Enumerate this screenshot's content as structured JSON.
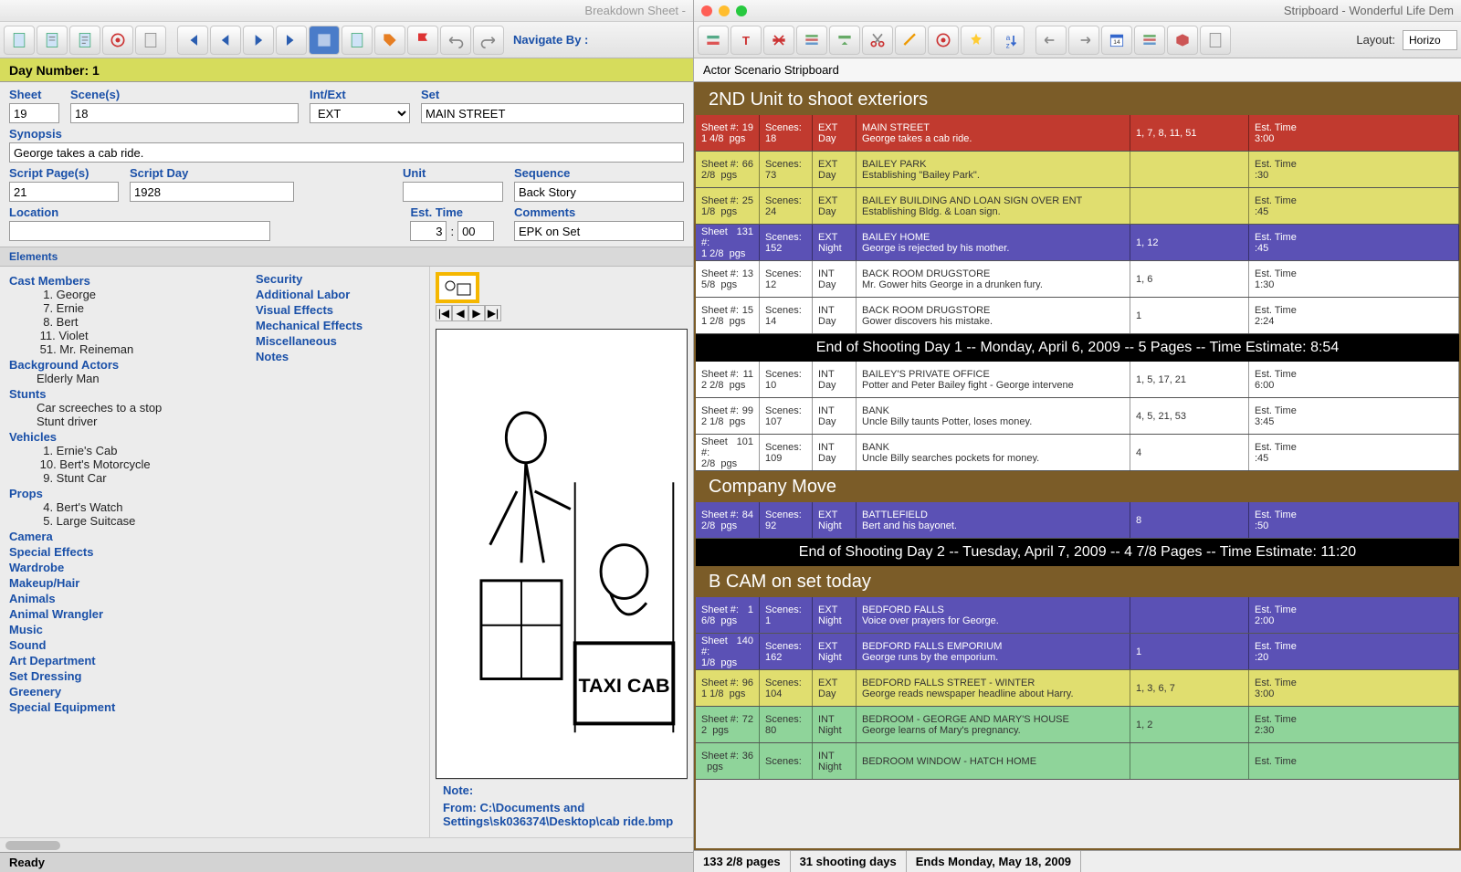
{
  "left": {
    "title": "Breakdown Sheet -",
    "daybar": "Day Number: 1",
    "labels": {
      "sheet": "Sheet",
      "scenes": "Scene(s)",
      "intext": "Int/Ext",
      "set": "Set",
      "synopsis": "Synopsis",
      "scriptpages": "Script Page(s)",
      "scriptday": "Script Day",
      "unit": "Unit",
      "sequence": "Sequence",
      "location": "Location",
      "esttime": "Est. Time",
      "comments": "Comments"
    },
    "vals": {
      "sheet": "19",
      "scenes": "18",
      "intext": "EXT",
      "set": "MAIN STREET",
      "synopsis": "George takes a cab ride.",
      "scriptpages": "21",
      "scriptday": "1928",
      "unit": "",
      "sequence": "Back Story",
      "location": "",
      "esttime_h": "3",
      "esttime_m": "00",
      "comments": "EPK on Set"
    },
    "elements_hdr": "Elements",
    "cats1": [
      {
        "name": "Cast Members",
        "items": [
          "  1. George",
          "  7. Ernie",
          "  8. Bert",
          " 11. Violet",
          " 51. Mr. Reineman"
        ]
      },
      {
        "name": "Background Actors",
        "items": [
          "Elderly Man"
        ]
      },
      {
        "name": "Stunts",
        "items": [
          "Car screeches to a stop",
          "Stunt driver"
        ]
      },
      {
        "name": "Vehicles",
        "items": [
          "  1. Ernie's Cab",
          " 10. Bert's Motorcycle",
          "  9. Stunt Car"
        ]
      },
      {
        "name": "Props",
        "items": [
          "  4. Bert's Watch",
          "  5. Large Suitcase"
        ]
      },
      {
        "name": "Camera",
        "items": []
      },
      {
        "name": "Special Effects",
        "items": []
      },
      {
        "name": "Wardrobe",
        "items": []
      },
      {
        "name": "Makeup/Hair",
        "items": []
      },
      {
        "name": "Animals",
        "items": []
      },
      {
        "name": "Animal Wrangler",
        "items": []
      },
      {
        "name": "Music",
        "items": []
      },
      {
        "name": "Sound",
        "items": []
      },
      {
        "name": "Art Department",
        "items": []
      },
      {
        "name": "Set Dressing",
        "items": []
      },
      {
        "name": "Greenery",
        "items": []
      },
      {
        "name": "Special Equipment",
        "items": []
      }
    ],
    "cats2": [
      "Security",
      "Additional Labor",
      "Visual Effects",
      "Mechanical Effects",
      "Miscellaneous",
      "Notes"
    ],
    "note_label": "Note:",
    "note_from": "From:  C:\\Documents and Settings\\sk036374\\Desktop\\cab ride.bmp",
    "status": "Ready",
    "navigate": "Navigate By :"
  },
  "right": {
    "title": "Stripboard - Wonderful Life Dem",
    "layout_label": "Layout:",
    "layout_value": "Horizo",
    "hdr": "Actor Scenario Stripboard",
    "banners": [
      "2ND Unit to shoot exteriors",
      "Company Move",
      "B CAM  on set today"
    ],
    "daybreaks": [
      "End of Shooting Day 1 -- Monday, April 6, 2009 -- 5 Pages -- Time Estimate: 8:54",
      "End of Shooting Day 2 -- Tuesday, April 7, 2009 -- 4 7/8 Pages -- Time Estimate: 11:20"
    ],
    "strips": [
      {
        "c": "c-red",
        "sheet": "19",
        "pgs": "1 4/8",
        "scn": "18",
        "ie": "EXT",
        "dn": "Day",
        "set": "MAIN STREET",
        "desc": "George takes a cab ride.",
        "ids": "1, 7, 8, 11, 51",
        "etl": "Est. Time",
        "et": "3:00"
      },
      {
        "c": "c-yellow",
        "sheet": "66",
        "pgs": "2/8",
        "scn": "73",
        "ie": "EXT",
        "dn": "Day",
        "set": "BAILEY PARK",
        "desc": "Establishing \"Bailey Park\".",
        "ids": "",
        "etl": "Est. Time",
        "et": ":30"
      },
      {
        "c": "c-yellow",
        "sheet": "25",
        "pgs": "1/8",
        "scn": "24",
        "ie": "EXT",
        "dn": "Day",
        "set": "BAILEY BUILDING AND LOAN SIGN OVER ENT",
        "desc": "Establishing Bldg. & Loan sign.",
        "ids": "",
        "etl": "Est. Time",
        "et": ":45"
      },
      {
        "c": "c-purple",
        "sheet": "131",
        "pgs": "1 2/8",
        "scn": "152",
        "ie": "EXT",
        "dn": "Night",
        "set": "BAILEY HOME",
        "desc": "George is rejected by his mother.",
        "ids": "1, 12",
        "etl": "Est. Time",
        "et": ":45"
      },
      {
        "c": "c-white",
        "sheet": "13",
        "pgs": "5/8",
        "scn": "12",
        "ie": "INT",
        "dn": "Day",
        "set": "BACK ROOM DRUGSTORE",
        "desc": "Mr. Gower hits George in a drunken fury.",
        "ids": "1, 6",
        "etl": "Est. Time",
        "et": "1:30"
      },
      {
        "c": "c-white",
        "sheet": "15",
        "pgs": "1 2/8",
        "scn": "14",
        "ie": "INT",
        "dn": "Day",
        "set": "BACK ROOM DRUGSTORE",
        "desc": "Gower discovers his mistake.",
        "ids": "1",
        "etl": "Est. Time",
        "et": "2:24"
      },
      {
        "c": "c-white",
        "sheet": "11",
        "pgs": "2 2/8",
        "scn": "10",
        "ie": "INT",
        "dn": "Day",
        "set": "BAILEY'S PRIVATE OFFICE",
        "desc": "Potter and Peter Bailey fight - George intervene",
        "ids": "1, 5, 17, 21",
        "etl": "Est. Time",
        "et": "6:00"
      },
      {
        "c": "c-white",
        "sheet": "99",
        "pgs": "2 1/8",
        "scn": "107",
        "ie": "INT",
        "dn": "Day",
        "set": "BANK",
        "desc": "Uncle Billy taunts Potter, loses money.",
        "ids": "4, 5, 21, 53",
        "etl": "Est. Time",
        "et": "3:45"
      },
      {
        "c": "c-white",
        "sheet": "101",
        "pgs": "2/8",
        "scn": "109",
        "ie": "INT",
        "dn": "Day",
        "set": "BANK",
        "desc": "Uncle Billy searches pockets for money.",
        "ids": "4",
        "etl": "Est. Time",
        "et": ":45"
      },
      {
        "c": "c-purple",
        "sheet": "84",
        "pgs": "2/8",
        "scn": "92",
        "ie": "EXT",
        "dn": "Night",
        "set": "BATTLEFIELD",
        "desc": "Bert and his bayonet.",
        "ids": "8",
        "etl": "Est. Time",
        "et": ":50"
      },
      {
        "c": "c-purple",
        "sheet": "1",
        "pgs": "6/8",
        "scn": "1",
        "ie": "EXT",
        "dn": "Night",
        "set": "BEDFORD FALLS",
        "desc": "Voice over prayers for George.",
        "ids": "",
        "etl": "Est. Time",
        "et": "2:00"
      },
      {
        "c": "c-purple",
        "sheet": "140",
        "pgs": "1/8",
        "scn": "162",
        "ie": "EXT",
        "dn": "Night",
        "set": "BEDFORD FALLS EMPORIUM",
        "desc": "George runs by the emporium.",
        "ids": "1",
        "etl": "Est. Time",
        "et": ":20"
      },
      {
        "c": "c-yellow",
        "sheet": "96",
        "pgs": "1 1/8",
        "scn": "104",
        "ie": "EXT",
        "dn": "Day",
        "set": "BEDFORD FALLS STREET - WINTER",
        "desc": "George reads newspaper headline about Harry.",
        "ids": "1, 3, 6, 7",
        "etl": "Est. Time",
        "et": "3:00"
      },
      {
        "c": "c-green",
        "sheet": "72",
        "pgs": "2",
        "scn": "80",
        "ie": "INT",
        "dn": "Night",
        "set": "BEDROOM - GEORGE AND MARY'S HOUSE",
        "desc": "George learns of Mary's pregnancy.",
        "ids": "1, 2",
        "etl": "Est. Time",
        "et": "2:30"
      },
      {
        "c": "c-green",
        "sheet": "36",
        "pgs": "",
        "scn": "",
        "ie": "INT",
        "dn": "Night",
        "set": "BEDROOM WINDOW - HATCH HOME",
        "desc": "",
        "ids": "",
        "etl": "Est. Time",
        "et": ""
      }
    ],
    "footer": {
      "pages": "133 2/8 pages",
      "days": "31 shooting days",
      "ends": "Ends Monday, May 18, 2009"
    }
  }
}
